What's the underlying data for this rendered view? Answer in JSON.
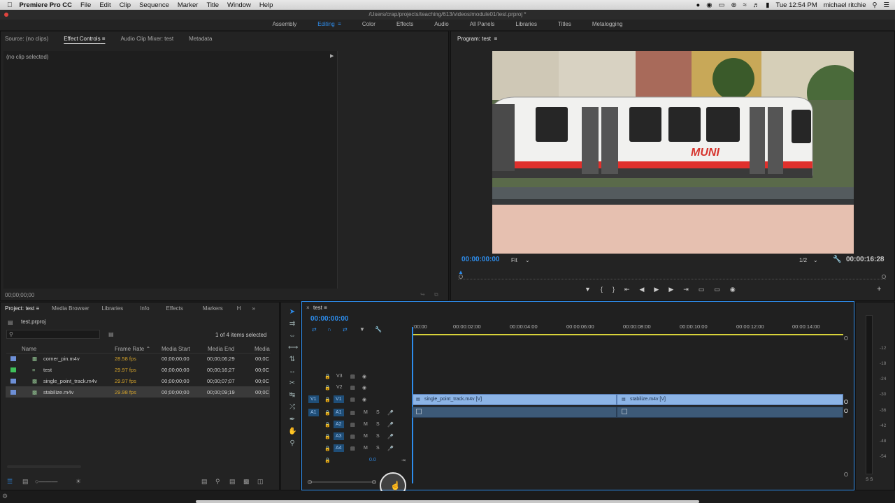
{
  "menubar": {
    "app_name": "Premiere Pro CC",
    "items": [
      "File",
      "Edit",
      "Clip",
      "Sequence",
      "Marker",
      "Title",
      "Window",
      "Help"
    ],
    "clock": "Tue 12:54 PM",
    "user": "michael ritchie"
  },
  "window_title": "/Users/crap/projects/teaching/613/videos/module01/test.prproj *",
  "workspaces": [
    "Assembly",
    "Editing",
    "Color",
    "Effects",
    "Audio",
    "All Panels",
    "Libraries",
    "Titles",
    "Metalogging"
  ],
  "source_panel": {
    "tabs": [
      "Source: (no clips)",
      "Effect Controls",
      "Audio Clip Mixer: test",
      "Metadata"
    ],
    "no_clip": "(no clip selected)",
    "timecode": "00;00;00;00"
  },
  "program_panel": {
    "title": "Program: test",
    "timecode": "00:00:00:00",
    "fit": "Fit",
    "resolution": "1/2",
    "duration": "00:00:16:28",
    "sign": "MUNI"
  },
  "project_panel": {
    "tabs": [
      "Project: test",
      "Media Browser",
      "Libraries",
      "Info",
      "Effects",
      "Markers",
      "H"
    ],
    "file": "test.prproj",
    "selection_count": "1 of 4 items selected",
    "columns": [
      "Name",
      "Frame Rate",
      "Media Start",
      "Media End",
      "Media"
    ],
    "rows": [
      {
        "name": "corner_pin.m4v",
        "rate": "28.58 fps",
        "start": "00;00;00;00",
        "end": "00;00;06;29",
        "media": "00;0C",
        "color": "#6d8fd6"
      },
      {
        "name": "test",
        "rate": "29.97 fps",
        "start": "00;00;00;00",
        "end": "00;00;16;27",
        "media": "00;0C",
        "color": "#3fbf5a"
      },
      {
        "name": "single_point_track.m4v",
        "rate": "29.97 fps",
        "start": "00;00;00;00",
        "end": "00;00;07;07",
        "media": "00;0C",
        "color": "#6d8fd6"
      },
      {
        "name": "stabilize.m4v",
        "rate": "29.98 fps",
        "start": "00;00;00;00",
        "end": "00;00;09;19",
        "media": "00;0C",
        "color": "#6d8fd6"
      }
    ]
  },
  "timeline": {
    "sequence": "test",
    "timecode": "00:00:00:00",
    "ruler": [
      ":00:00",
      "00:00:02:00",
      "00:00:04:00",
      "00:00:06:00",
      "00:00:08:00",
      "00:00:10:00",
      "00:00:12:00",
      "00:00:14:00"
    ],
    "video_tracks": [
      "V3",
      "V2",
      "V1"
    ],
    "audio_tracks": [
      "A1",
      "A2",
      "A3",
      "A4"
    ],
    "source_v": "V1",
    "source_a": "A1",
    "master_level": "0.0",
    "clips": [
      "single_point_track.m4v [V]",
      "stabilize.m4v [V]"
    ],
    "track_m": "M",
    "track_s": "S"
  },
  "meter_labels": [
    "-12",
    "-18",
    "-24",
    "-30",
    "-36",
    "-42",
    "-48",
    "-54"
  ],
  "meter_ss": "S S"
}
